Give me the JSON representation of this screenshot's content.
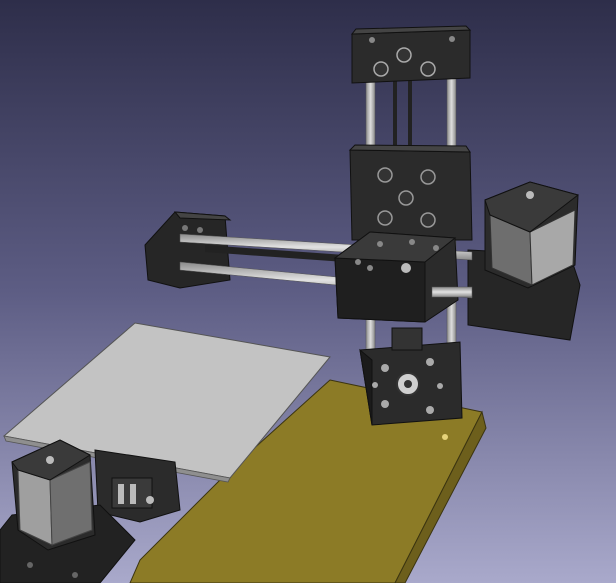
{
  "view": {
    "background_top": "#2e2e4a",
    "background_bottom": "#a9a9cb",
    "base_color": "#8c7b26",
    "bed_color": "#bfbfbf",
    "part_color": "#2a2a2a",
    "rod_color": "#b9b9b9"
  }
}
